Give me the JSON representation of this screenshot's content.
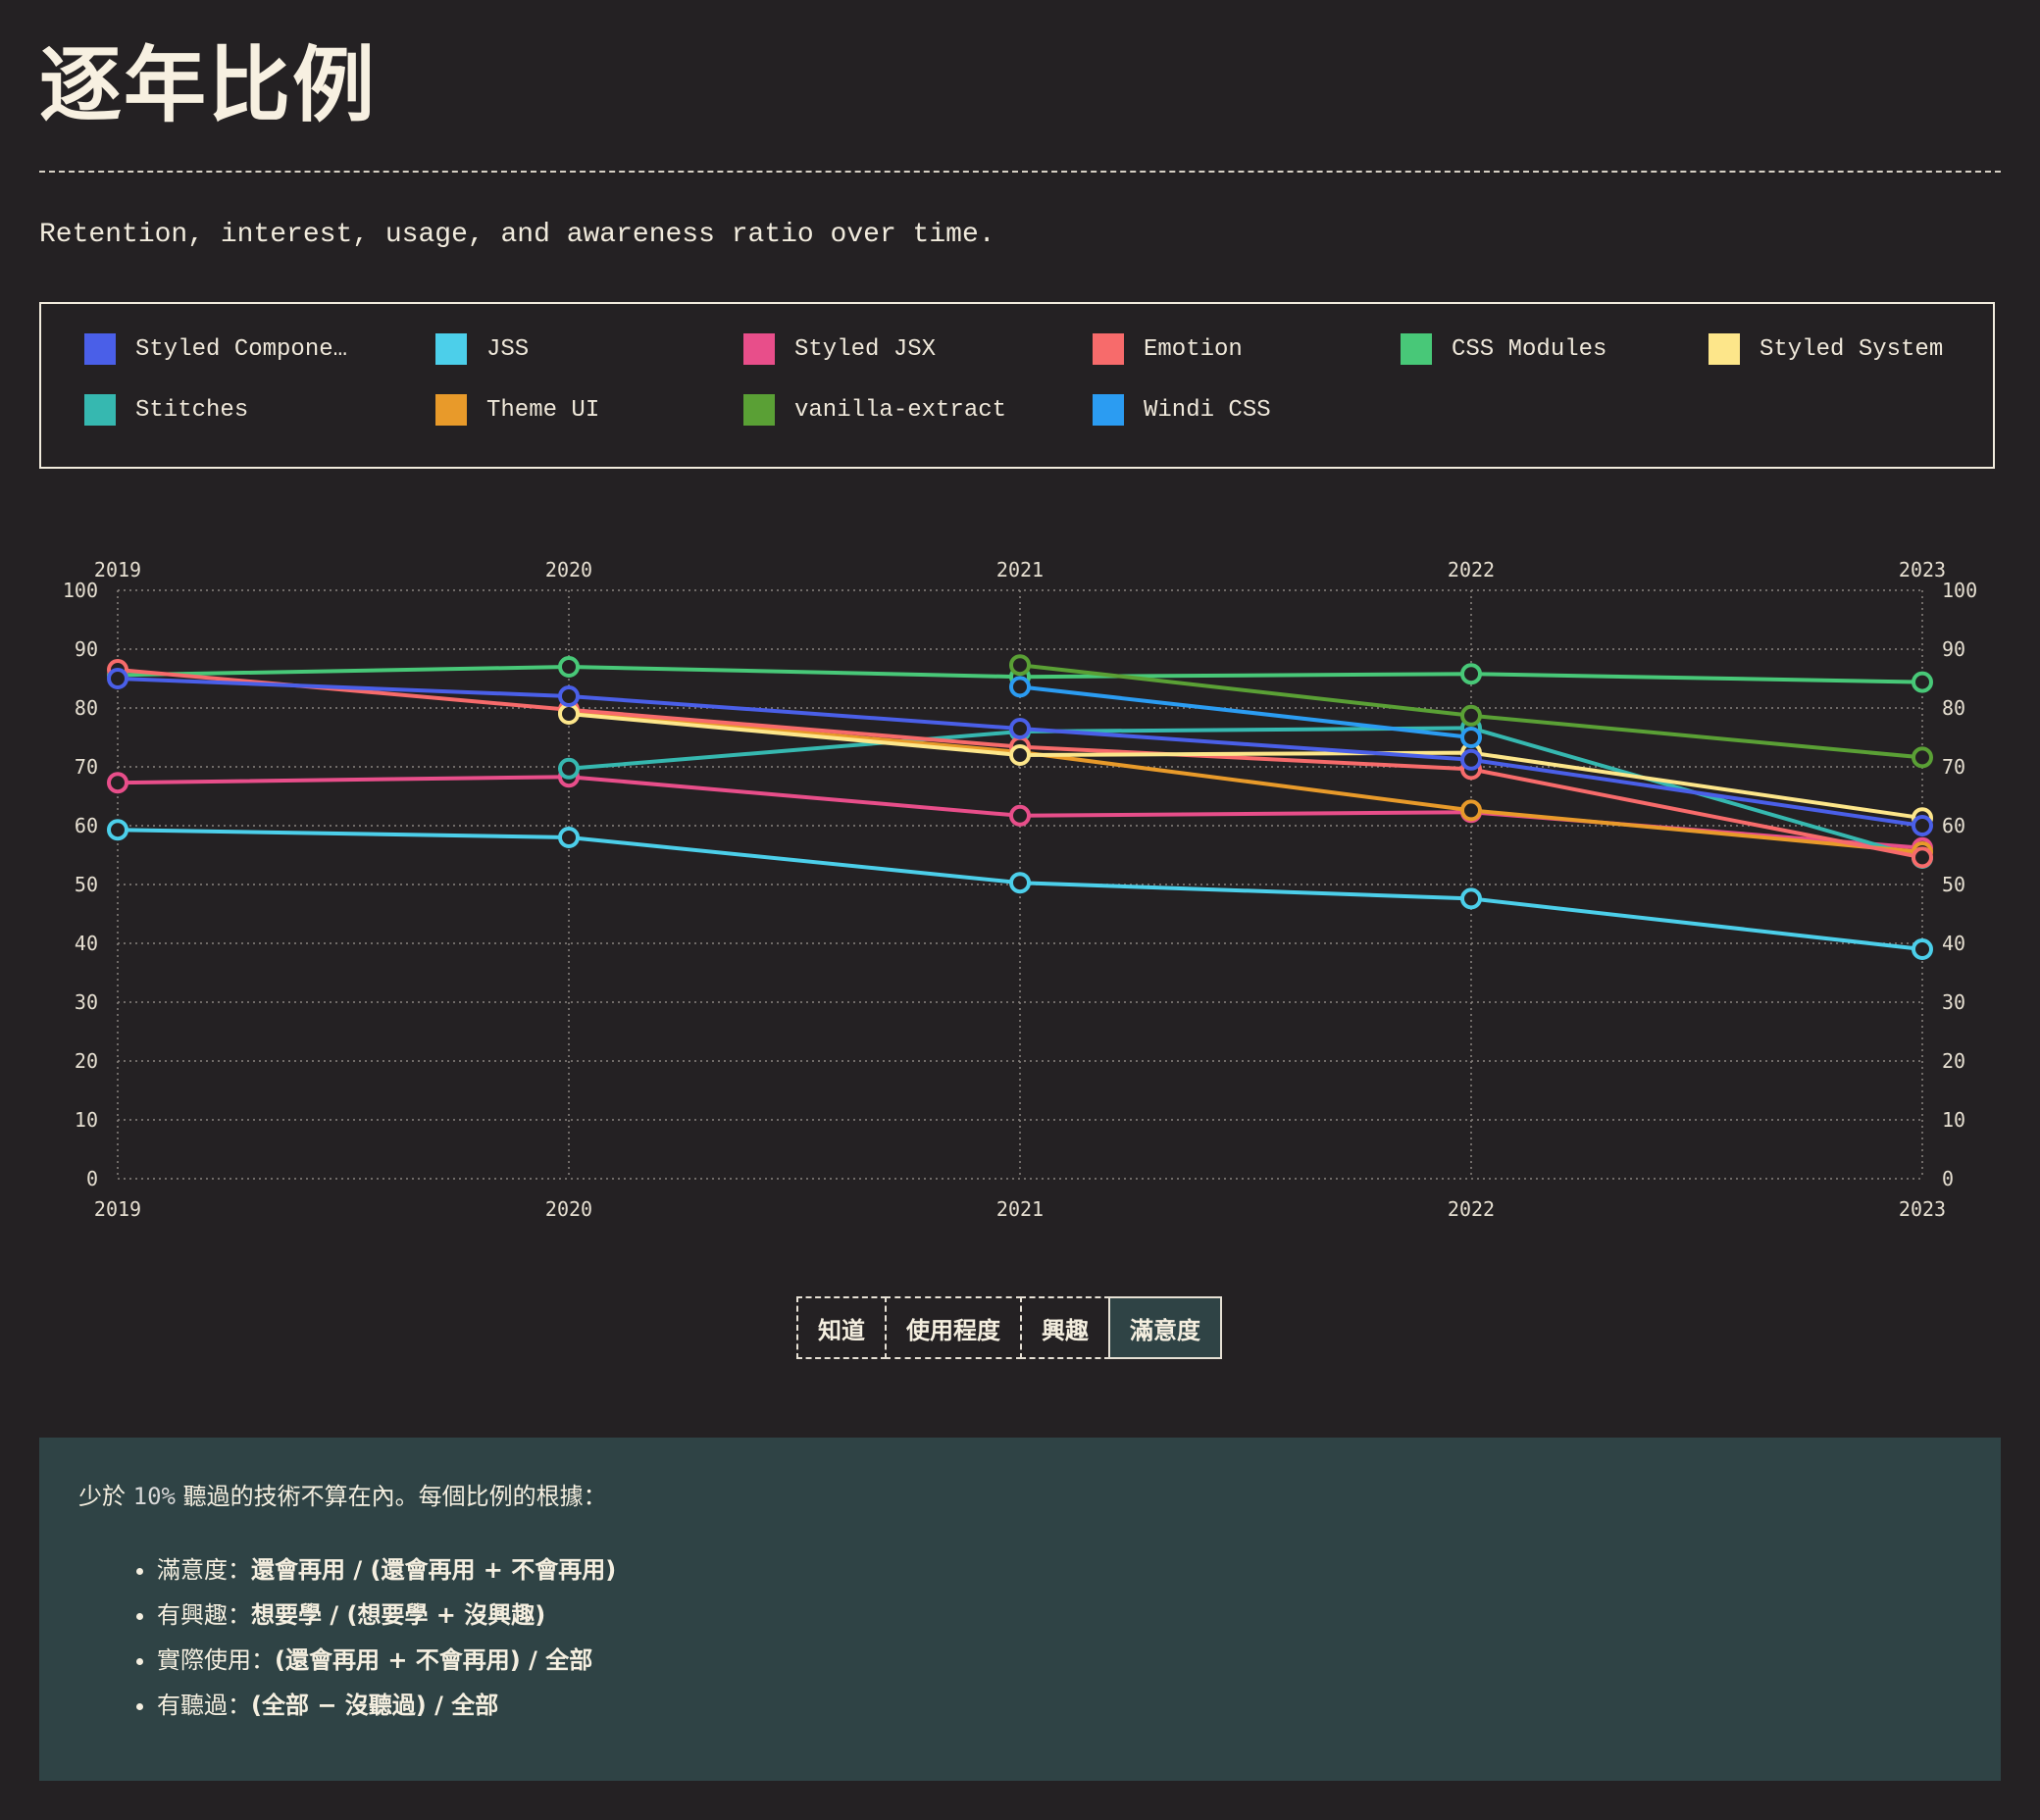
{
  "header": {
    "title": "逐年比例",
    "subtitle": "Retention, interest, usage, and awareness ratio over time."
  },
  "legend": [
    {
      "label": "Styled Compone…",
      "color": "#4a5fe8"
    },
    {
      "label": "JSS",
      "color": "#4ccfea"
    },
    {
      "label": "Styled JSX",
      "color": "#e84e8a"
    },
    {
      "label": "Emotion",
      "color": "#f76b6b"
    },
    {
      "label": "CSS Modules",
      "color": "#48c878"
    },
    {
      "label": "Styled System",
      "color": "#fde68a"
    },
    {
      "label": "Stitches",
      "color": "#36b8b0"
    },
    {
      "label": "Theme UI",
      "color": "#e89a2a"
    },
    {
      "label": "vanilla-extract",
      "color": "#5aa035"
    },
    {
      "label": "Windi CSS",
      "color": "#2b9cf2"
    }
  ],
  "chart_data": {
    "type": "line",
    "x": [
      "2019",
      "2020",
      "2021",
      "2022",
      "2023"
    ],
    "ylim": [
      0,
      100
    ],
    "yticks": [
      0,
      10,
      20,
      30,
      40,
      50,
      60,
      70,
      80,
      90,
      100
    ],
    "grid": true,
    "series": [
      {
        "name": "CSS Modules",
        "color": "#48c878",
        "values": [
          85.6,
          87.0,
          85.3,
          85.8,
          84.4
        ]
      },
      {
        "name": "JSS",
        "color": "#4ccfea",
        "values": [
          59.3,
          58.0,
          50.3,
          47.6,
          39.0
        ]
      },
      {
        "name": "Styled JSX",
        "color": "#e84e8a",
        "values": [
          67.3,
          68.3,
          61.7,
          62.3,
          56.2
        ]
      },
      {
        "name": "Stitches",
        "color": "#36b8b0",
        "values": [
          null,
          69.7,
          76.0,
          76.6,
          54.5
        ]
      },
      {
        "name": "Theme UI",
        "color": "#e89a2a",
        "values": [
          null,
          79.4,
          72.5,
          62.6,
          55.5
        ]
      },
      {
        "name": "Emotion",
        "color": "#f76b6b",
        "values": [
          86.5,
          79.7,
          73.4,
          69.6,
          54.6
        ]
      },
      {
        "name": "Styled System",
        "color": "#fde68a",
        "values": [
          null,
          79.0,
          72.0,
          72.4,
          61.3
        ]
      },
      {
        "name": "Windi CSS",
        "color": "#2b9cf2",
        "values": [
          null,
          null,
          83.6,
          75.0,
          null
        ]
      },
      {
        "name": "vanilla-extract",
        "color": "#5aa035",
        "values": [
          null,
          null,
          87.3,
          78.7,
          71.6
        ]
      },
      {
        "name": "Styled Components",
        "color": "#4a5fe8",
        "values": [
          85.0,
          82.0,
          76.5,
          71.2,
          60.0
        ]
      }
    ]
  },
  "tabs": [
    {
      "label": "知道",
      "active": false
    },
    {
      "label": "使用程度",
      "active": false
    },
    {
      "label": "興趣",
      "active": false
    },
    {
      "label": "滿意度",
      "active": true
    }
  ],
  "note": {
    "intro_pre": "少於",
    "intro_pct": "10%",
    "intro_post": "聽過的技術不算在內。每個比例的根據：",
    "items": [
      {
        "label": "滿意度：",
        "formula": "還會再用 / (還會再用 + 不會再用)"
      },
      {
        "label": "有興趣：",
        "formula": "想要學 / (想要學 + 沒興趣)"
      },
      {
        "label": "實際使用：",
        "formula": "(還會再用 + 不會再用) / 全部"
      },
      {
        "label": "有聽過：",
        "formula": "(全部 − 沒聽過) / 全部"
      }
    ]
  }
}
